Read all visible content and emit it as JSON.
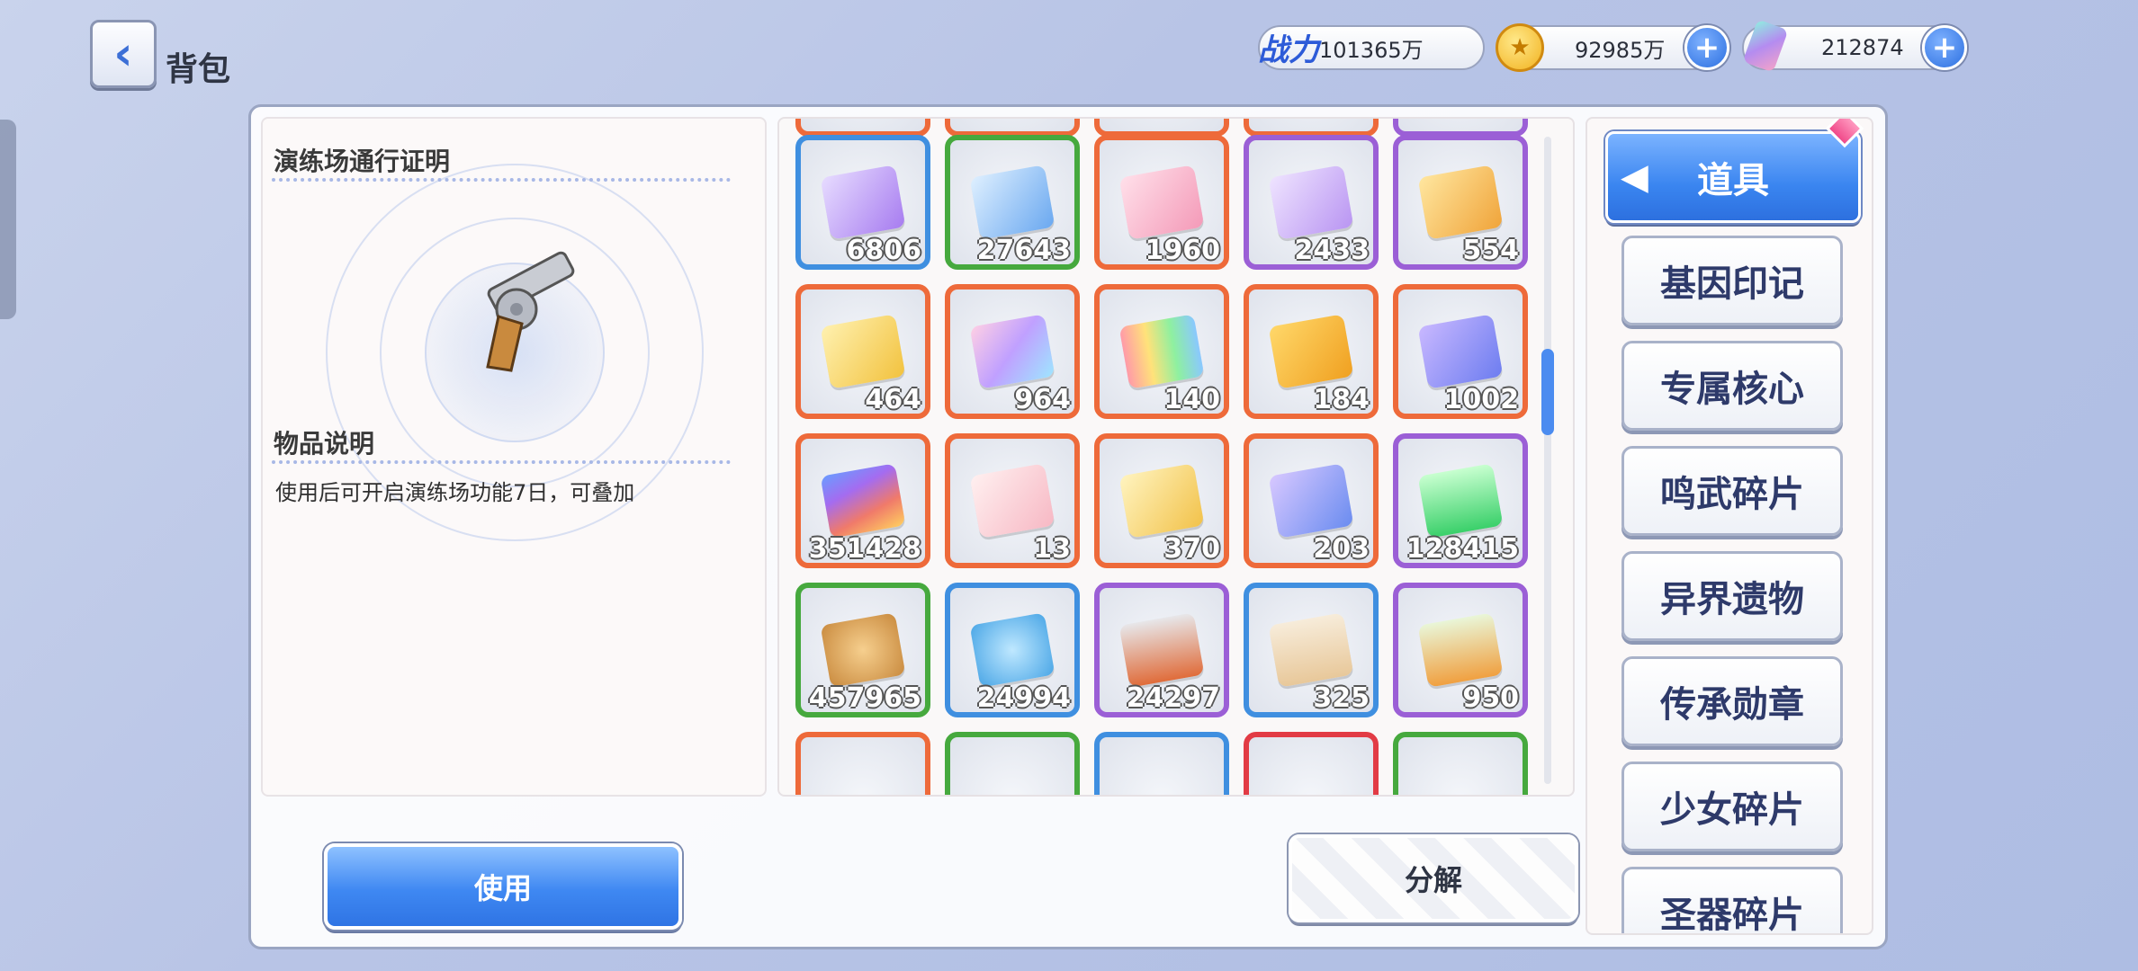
{
  "header": {
    "title": "背包"
  },
  "resources": {
    "power": {
      "icon_label": "战力",
      "value": "101365万"
    },
    "gold": {
      "value": "92985万"
    },
    "gem": {
      "value": "212874"
    }
  },
  "detail": {
    "item_name": "演练场通行证明",
    "desc_heading": "物品说明",
    "description": "使用后可开启演练场功能7日，可叠加",
    "use_label": "使用"
  },
  "grid": {
    "split_label": "分解",
    "items": [
      {
        "count": "6806",
        "rarity": "blue",
        "icon": "crystal-statue-purple"
      },
      {
        "count": "27643",
        "rarity": "green",
        "icon": "crystal-statue-blue"
      },
      {
        "count": "1960",
        "rarity": "orange",
        "icon": "ticket-shirt-pink"
      },
      {
        "count": "2433",
        "rarity": "purple",
        "icon": "ticket-smile-purple"
      },
      {
        "count": "554",
        "rarity": "purple",
        "icon": "card-dna-gold"
      },
      {
        "count": "464",
        "rarity": "orange",
        "icon": "card-sparkle-gold"
      },
      {
        "count": "964",
        "rarity": "orange",
        "icon": "card-dna-rainbow"
      },
      {
        "count": "140",
        "rarity": "orange",
        "icon": "ticket-rainbow"
      },
      {
        "count": "184",
        "rarity": "orange",
        "icon": "card-sword-gold"
      },
      {
        "count": "1002",
        "rarity": "orange",
        "icon": "card-sword-purple"
      },
      {
        "count": "351428",
        "rarity": "orange",
        "icon": "crystal-rainbow"
      },
      {
        "count": "13",
        "rarity": "orange",
        "icon": "ticket-cake-pink"
      },
      {
        "count": "370",
        "rarity": "orange",
        "icon": "card-star-gold"
      },
      {
        "count": "203",
        "rarity": "orange",
        "icon": "card-star-blue"
      },
      {
        "count": "128415",
        "rarity": "purple",
        "icon": "potion-green"
      },
      {
        "count": "457965",
        "rarity": "green",
        "icon": "cookie"
      },
      {
        "count": "24994",
        "rarity": "blue",
        "icon": "candy-blue"
      },
      {
        "count": "24297",
        "rarity": "purple",
        "icon": "can-food"
      },
      {
        "count": "325",
        "rarity": "blue",
        "icon": "food-bag"
      },
      {
        "count": "950",
        "rarity": "purple",
        "icon": "carrot-bag"
      }
    ],
    "top_partial": [
      "orange",
      "orange",
      "orange",
      "orange",
      "purple"
    ],
    "bottom_partial": [
      "orange",
      "green",
      "blue",
      "red",
      "green"
    ]
  },
  "categories": {
    "selected": "道具",
    "items": [
      "基因印记",
      "专属核心",
      "鸣武碎片",
      "异界遗物",
      "传承勋章",
      "少女碎片",
      "圣器碎片"
    ]
  },
  "colors": {
    "blue": "#3f8fe0",
    "green": "#46a93e",
    "orange": "#ee6a3a",
    "purple": "#9b5fd6",
    "red": "#e23b45"
  }
}
